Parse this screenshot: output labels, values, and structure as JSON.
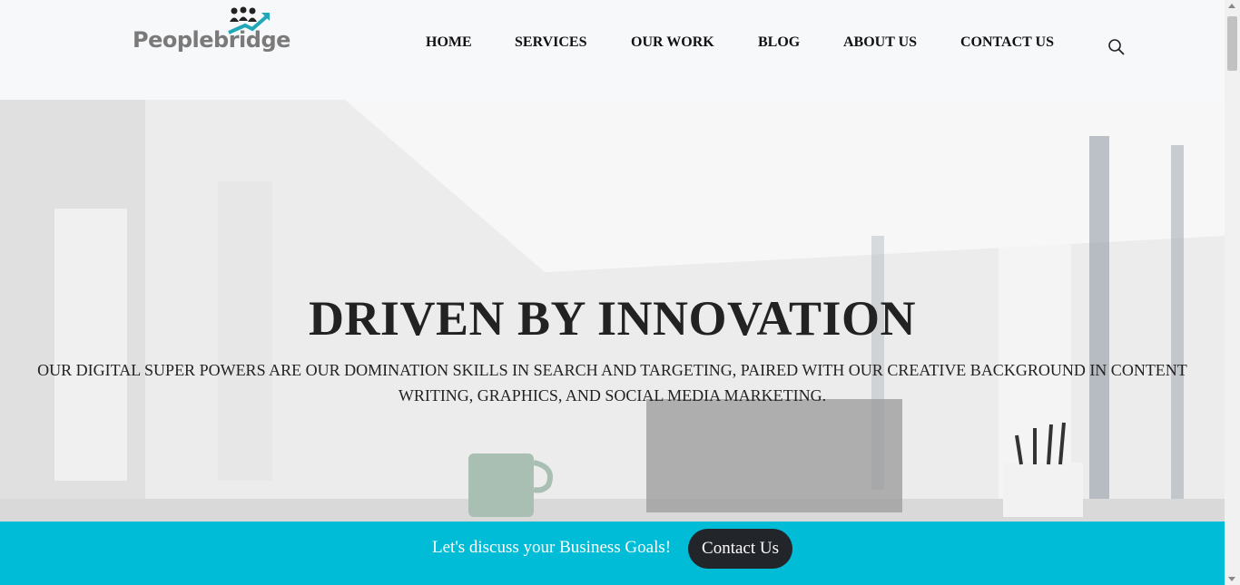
{
  "brand": {
    "name": "Peoplebridge",
    "text_color": "#7a7a7a",
    "accent": "#1fa8b8"
  },
  "nav": {
    "items": [
      {
        "label": "HOME"
      },
      {
        "label": "SERVICES"
      },
      {
        "label": "OUR WORK"
      },
      {
        "label": "BLOG"
      },
      {
        "label": "ABOUT US"
      },
      {
        "label": "CONTACT US"
      }
    ],
    "search_icon": "search-icon"
  },
  "hero": {
    "title": "DRIVEN BY INNOVATION",
    "subtitle": "OUR DIGITAL SUPER POWERS ARE OUR DOMINATION SKILLS IN SEARCH AND TARGETING, PAIRED WITH OUR CREATIVE BACKGROUND IN CONTENT WRITING, GRAPHICS, AND SOCIAL MEDIA MARKETING."
  },
  "cta": {
    "text": "Let's discuss your Business Goals!",
    "button_label": "Contact Us",
    "bar_color": "#00bcd6",
    "button_color": "#222529"
  }
}
